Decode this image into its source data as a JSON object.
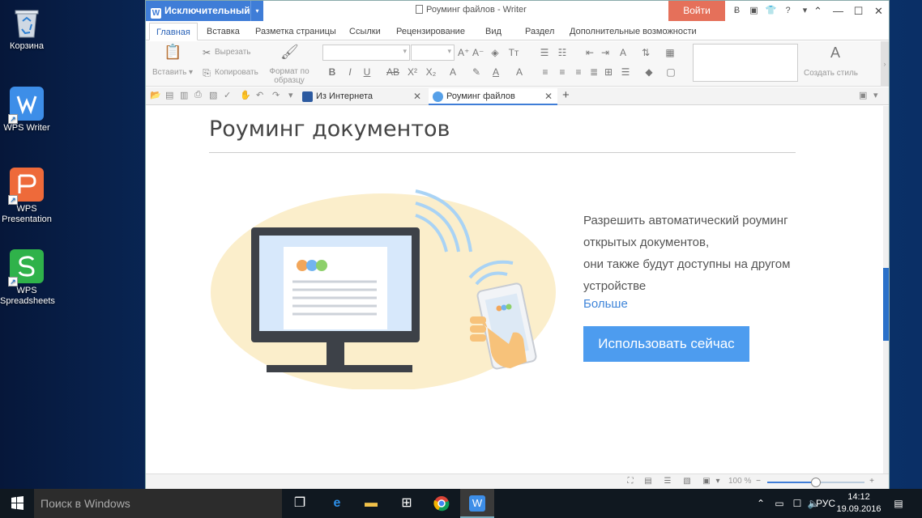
{
  "desktop": {
    "icons": [
      {
        "label": "Корзина"
      },
      {
        "label": "WPS Writer"
      },
      {
        "label": "WPS Presentation"
      },
      {
        "label": "WPS Spreadsheets"
      }
    ]
  },
  "window": {
    "brand": "Исключительный",
    "title": "Роуминг файлов - Writer",
    "login": "Войти",
    "controls": [
      "?",
      "—",
      "☐",
      "✕"
    ]
  },
  "ribbon_tabs": [
    "Главная",
    "Вставка",
    "Разметка страницы",
    "Ссылки",
    "Рецензирование",
    "Вид",
    "Раздел",
    "Дополнительные возможности"
  ],
  "ribbon": {
    "paste": "Вставить",
    "cut": "Вырезать",
    "copy": "Копировать",
    "format_painter": "Формат по образцу",
    "create_style": "Создать стиль"
  },
  "doc_tabs": [
    {
      "label": "Из Интернета",
      "active": false
    },
    {
      "label": "Роуминг файлов",
      "active": true
    }
  ],
  "page": {
    "title": "Роуминг документов",
    "promo_lines": [
      "Разрешить автоматический роуминг",
      "открытых документов,",
      "они также будут доступны на другом",
      "устройстве"
    ],
    "link": "Больше",
    "button": "Использовать сейчас"
  },
  "statusbar": {
    "zoom": "100 %",
    "zoom_fraction": 0.5
  },
  "taskbar": {
    "search_placeholder": "Поиск в Windows",
    "lang": "РУС",
    "time": "14:12",
    "date": "19.09.2016"
  },
  "colors": {
    "accent": "#3f7dd7",
    "login": "#e5705a",
    "button": "#4d9cef",
    "link": "#3f85d9"
  }
}
